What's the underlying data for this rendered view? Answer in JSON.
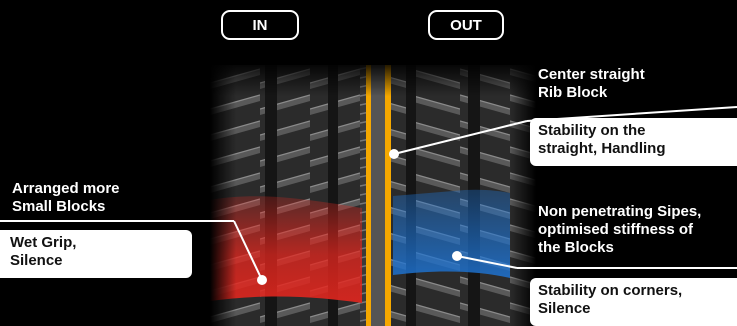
{
  "header": {
    "in_label": "IN",
    "out_label": "OUT"
  },
  "callouts": {
    "center": {
      "title_line1": "Center straight",
      "title_line2": "Rib Block",
      "benefit_line1": "Stability on the",
      "benefit_line2": "straight, Handling"
    },
    "small_blocks": {
      "title_line1": "Arranged more",
      "title_line2": "Small Blocks",
      "benefit_line1": "Wet Grip,",
      "benefit_line2": "Silence"
    },
    "sipes": {
      "title_line1": "Non penetrating Sipes,",
      "title_line2": "optimised stiffness of",
      "title_line3": "the Blocks",
      "benefit_line1": "Stability on corners,",
      "benefit_line2": "Silence"
    }
  },
  "colors": {
    "center_rib": "#f5a800",
    "inner_zone": "#e3261e",
    "outer_zone": "#1e73d2",
    "background": "#000000",
    "box": "#ffffff"
  }
}
